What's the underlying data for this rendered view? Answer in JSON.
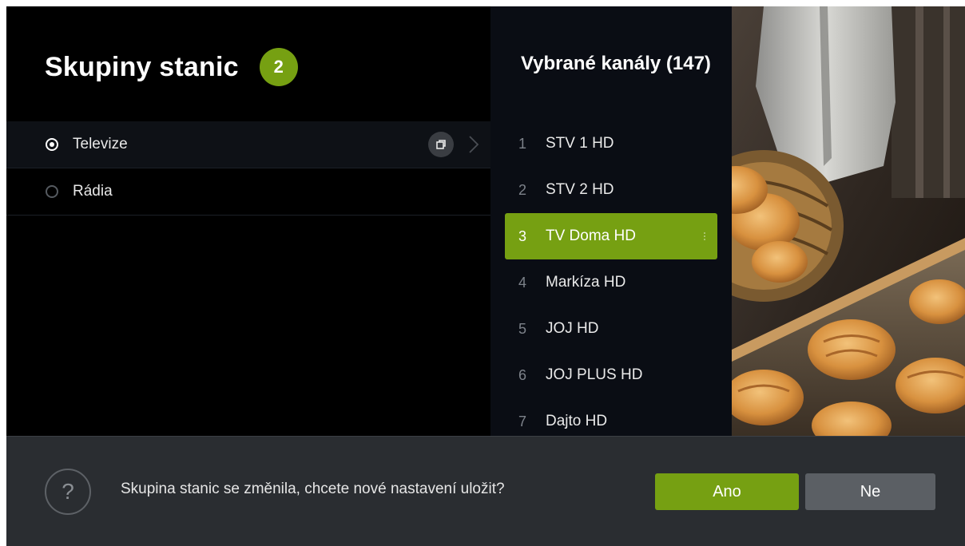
{
  "header": {
    "title": "Skupiny stanic",
    "count_badge": "2"
  },
  "groups": [
    {
      "label": "Televize",
      "selected": true
    },
    {
      "label": "Rádia",
      "selected": false
    }
  ],
  "channels": {
    "title": "Vybrané kanály (147)",
    "items": [
      {
        "num": "1",
        "name": "STV 1 HD"
      },
      {
        "num": "2",
        "name": "STV 2 HD"
      },
      {
        "num": "3",
        "name": "TV Doma HD"
      },
      {
        "num": "4",
        "name": "Markíza HD"
      },
      {
        "num": "5",
        "name": "JOJ HD"
      },
      {
        "num": "6",
        "name": "JOJ PLUS HD"
      },
      {
        "num": "7",
        "name": "Dajto HD"
      }
    ],
    "selected_index": 2
  },
  "dialog": {
    "message": "Skupina stanic se změnila, chcete nové nastavení uložit?",
    "yes_label": "Ano",
    "no_label": "Ne",
    "help_icon": "question-mark-icon"
  },
  "colors": {
    "accent": "#76a012",
    "background": "#000000",
    "channel_panel": "#0a0d14",
    "dialog_bar": "#2a2d31",
    "secondary_button": "#5b5f64"
  }
}
